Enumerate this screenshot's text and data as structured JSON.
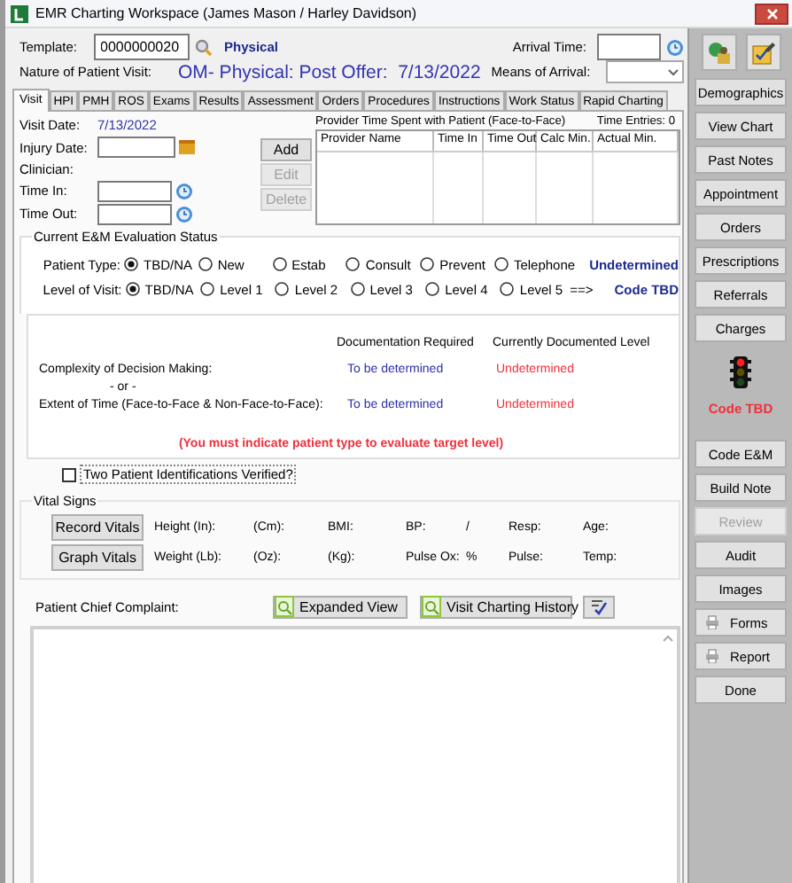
{
  "window": {
    "title": "EMR Charting Workspace (James Mason / Harley Davidson)"
  },
  "header": {
    "template_label": "Template:",
    "template_value": "0000000020",
    "template_type": "Physical",
    "arrival_time_label": "Arrival Time:",
    "nature_label": "Nature of Patient Visit:",
    "nature_value": "OM- Physical: Post Offer:  7/13/2022",
    "means_label": "Means of Arrival:"
  },
  "tabs": [
    {
      "label": "Visit",
      "selected": true
    },
    {
      "label": "HPI",
      "selected": false
    },
    {
      "label": "PMH",
      "selected": false
    },
    {
      "label": "ROS",
      "selected": false
    },
    {
      "label": "Exams",
      "selected": false
    },
    {
      "label": "Results",
      "selected": false
    },
    {
      "label": "Assessment",
      "selected": false
    },
    {
      "label": "Orders",
      "selected": false
    },
    {
      "label": "Procedures",
      "selected": false
    },
    {
      "label": "Instructions",
      "selected": false
    },
    {
      "label": "Work Status",
      "selected": false
    },
    {
      "label": "Rapid Charting",
      "selected": false
    }
  ],
  "visit": {
    "visit_date_label": "Visit Date:",
    "visit_date": "7/13/2022",
    "injury_date_label": "Injury Date:",
    "clinician_label": "Clinician:",
    "time_in_label": "Time In:",
    "time_out_label": "Time Out:",
    "buttons": [
      {
        "label": "Add",
        "disabled": false
      },
      {
        "label": "Edit",
        "disabled": true
      },
      {
        "label": "Delete",
        "disabled": true
      }
    ],
    "provider_time": {
      "title": "Provider Time Spent with Patient (Face-to-Face)",
      "entries": "Time Entries: 0",
      "columns": [
        "Provider Name",
        "Time In",
        "Time Out",
        "Calc Min.",
        "Actual Min."
      ]
    }
  },
  "em_status": {
    "title": "Current E&M Evaluation Status",
    "patient_type": {
      "label": "Patient Type:",
      "result": "Undetermined",
      "options": [
        {
          "label": "TBD/NA",
          "selected": true
        },
        {
          "label": "New",
          "selected": false
        },
        {
          "label": "Estab",
          "selected": false
        },
        {
          "label": "Consult",
          "selected": false
        },
        {
          "label": "Prevent",
          "selected": false
        },
        {
          "label": "Telephone",
          "selected": false
        }
      ]
    },
    "level_of_visit": {
      "label": "Level of Visit:",
      "arrow": "==>",
      "result": "Code TBD",
      "options": [
        {
          "label": "TBD/NA",
          "selected": true
        },
        {
          "label": "Level 1",
          "selected": false
        },
        {
          "label": "Level 2",
          "selected": false
        },
        {
          "label": "Level 3",
          "selected": false
        },
        {
          "label": "Level 4",
          "selected": false
        },
        {
          "label": "Level 5",
          "selected": false
        }
      ]
    },
    "documentation": {
      "columns": [
        "Documentation Required",
        "Currently Documented Level"
      ],
      "separator": "- or -",
      "warning": "(You must indicate patient type to evaluate target level)",
      "rows": [
        {
          "label": "Complexity of Decision Making:",
          "required": "To be determined",
          "current": "Undetermined"
        },
        {
          "label": "Extent of Time (Face-to-Face & Non-Face-to-Face):",
          "required": "To be determined",
          "current": "Undetermined"
        }
      ]
    }
  },
  "identification_check": {
    "label": "Two Patient Identifications Verified?",
    "checked": false
  },
  "vital_signs": {
    "title": "Vital Signs",
    "buttons": [
      "Record Vitals",
      "Graph Vitals"
    ],
    "rows": [
      [
        "Height  (In):",
        "(Cm):",
        "BMI:",
        "BP:",
        "/",
        "Resp:",
        "Age:"
      ],
      [
        "Weight (Lb):",
        "(Oz):",
        "(Kg):",
        "Pulse Ox:",
        "%",
        "Pulse:",
        "Temp:"
      ]
    ]
  },
  "chief_complaint": {
    "label": "Patient Chief Complaint:",
    "buttons": [
      "Expanded View",
      "Visit Charting History"
    ]
  },
  "sidebar": {
    "status": "Code TBD",
    "buttons": [
      {
        "label": "Demographics",
        "disabled": false,
        "kind": "plain"
      },
      {
        "label": "View Chart",
        "disabled": false,
        "kind": "plain"
      },
      {
        "label": "Past Notes",
        "disabled": false,
        "kind": "plain"
      },
      {
        "label": "Appointment",
        "disabled": false,
        "kind": "plain"
      },
      {
        "label": "Orders",
        "disabled": false,
        "kind": "plain"
      },
      {
        "label": "Prescriptions",
        "disabled": false,
        "kind": "plain"
      },
      {
        "label": "Referrals",
        "disabled": false,
        "kind": "plain"
      },
      {
        "label": "Charges",
        "disabled": false,
        "kind": "plain"
      }
    ],
    "more_buttons": [
      {
        "label": "Code E&M",
        "disabled": false,
        "kind": "plain"
      },
      {
        "label": "Build Note",
        "disabled": false,
        "kind": "plain"
      },
      {
        "label": "Review",
        "disabled": true,
        "kind": "plain"
      },
      {
        "label": "Audit",
        "disabled": false,
        "kind": "plain"
      },
      {
        "label": "Images",
        "disabled": false,
        "kind": "plain"
      },
      {
        "label": "Forms",
        "disabled": false,
        "kind": "print"
      },
      {
        "label": "Report",
        "disabled": false,
        "kind": "print"
      },
      {
        "label": "Done",
        "disabled": false,
        "kind": "plain"
      }
    ]
  }
}
